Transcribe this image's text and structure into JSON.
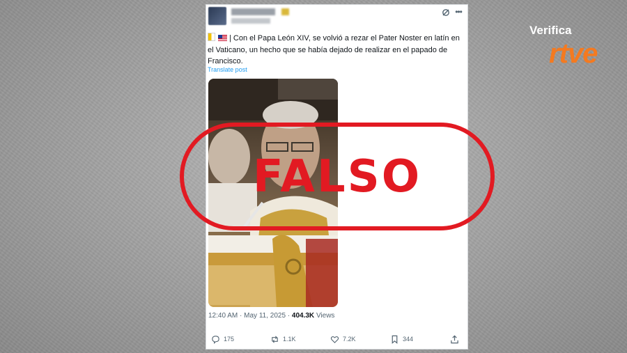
{
  "tweet": {
    "user_name": "■■■■■■■■■ ✨",
    "user_handle": "■■■■ ■■■■■",
    "text": "| Con el Papa León XIV, se volvió a rezar el Pater Noster en latín en el Vaticano, un hecho que se había dejado de realizar en el papado de Francisco.",
    "translate_label": "Translate post",
    "time": "12:40 AM",
    "separator": " · ",
    "date": "May 11, 2025",
    "views_count": "404.3K",
    "views_label": "Views",
    "actions": {
      "replies": "175",
      "reposts": "1.1K",
      "likes": "7.2K",
      "bookmarks": "344"
    }
  },
  "stamp": {
    "label": "FALSO",
    "color": "#e21a22"
  },
  "brand": {
    "verifica": "Verifica",
    "rtve": "rtve",
    "accent": "#f47a20"
  },
  "icons": [
    "grok-icon",
    "more-icon",
    "flag-vatican-icon",
    "flag-us-icon",
    "reply-icon",
    "repost-icon",
    "like-icon",
    "bookmark-icon",
    "share-icon"
  ]
}
